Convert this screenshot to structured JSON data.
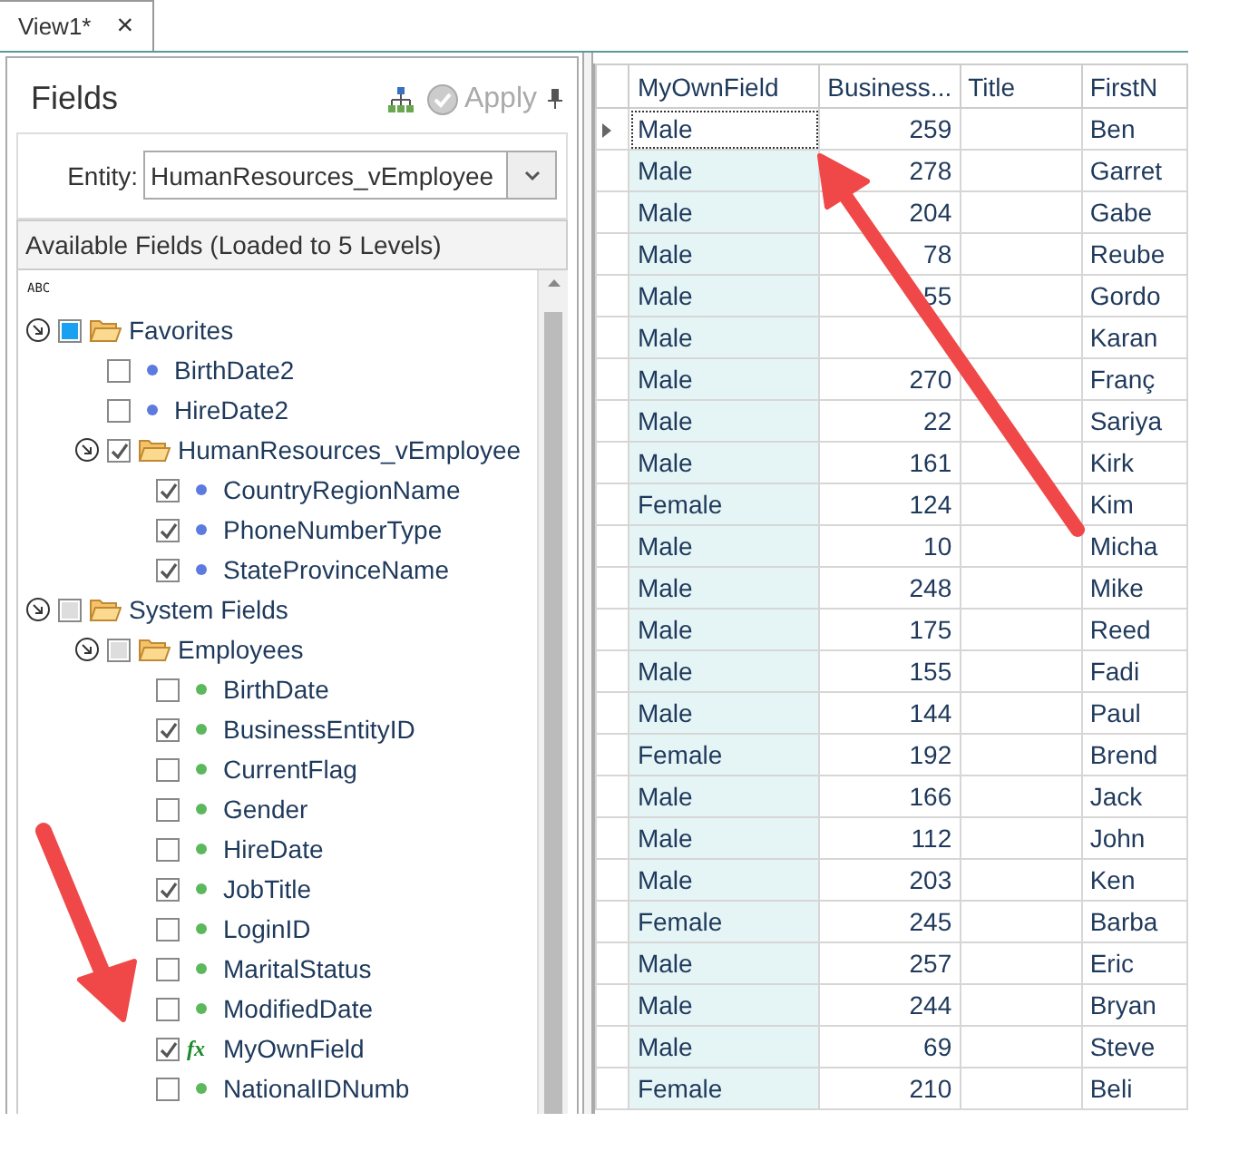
{
  "tab": {
    "label": "View1*",
    "close": "×"
  },
  "fields_panel": {
    "title": "Fields",
    "apply_button": {
      "label": "Apply",
      "disabled": true
    },
    "entity": {
      "label": "Entity:",
      "value": "HumanResources_vEmployee"
    },
    "available_header": "Available Fields (Loaded to 5 Levels)",
    "sort_button": "ABC",
    "tree": [
      {
        "kind": "folder",
        "label": "Favorites",
        "checked": false,
        "partial": true,
        "color": "#1aa0f0",
        "expanded": true,
        "children": [
          {
            "kind": "field",
            "label": "BirthDate2",
            "checked": false,
            "color": "#5b7be0"
          },
          {
            "kind": "field",
            "label": "HireDate2",
            "checked": false,
            "color": "#5b7be0"
          },
          {
            "kind": "folder",
            "label": "HumanResources_vEmployee",
            "checked": true,
            "expanded": true,
            "children": [
              {
                "kind": "field",
                "label": "CountryRegionName",
                "checked": true,
                "color": "#5b7be0"
              },
              {
                "kind": "field",
                "label": "PhoneNumberType",
                "checked": true,
                "color": "#5b7be0"
              },
              {
                "kind": "field",
                "label": "StateProvinceName",
                "checked": true,
                "color": "#5b7be0"
              }
            ]
          }
        ]
      },
      {
        "kind": "folder",
        "label": "System Fields",
        "checked": false,
        "partial": true,
        "color": "#dddddd",
        "expanded": true,
        "children": [
          {
            "kind": "folder",
            "label": "Employees",
            "checked": false,
            "partial": true,
            "color": "#dddddd",
            "expanded": true,
            "children": [
              {
                "kind": "field",
                "label": "BirthDate",
                "checked": false,
                "color": "#5cb85c"
              },
              {
                "kind": "field",
                "label": "BusinessEntityID",
                "checked": true,
                "color": "#5cb85c"
              },
              {
                "kind": "field",
                "label": "CurrentFlag",
                "checked": false,
                "color": "#5cb85c"
              },
              {
                "kind": "field",
                "label": "Gender",
                "checked": false,
                "color": "#5cb85c"
              },
              {
                "kind": "field",
                "label": "HireDate",
                "checked": false,
                "color": "#5cb85c"
              },
              {
                "kind": "field",
                "label": "JobTitle",
                "checked": true,
                "color": "#5cb85c"
              },
              {
                "kind": "field",
                "label": "LoginID",
                "checked": false,
                "color": "#5cb85c"
              },
              {
                "kind": "field",
                "label": "MaritalStatus",
                "checked": false,
                "color": "#5cb85c"
              },
              {
                "kind": "field",
                "label": "ModifiedDate",
                "checked": false,
                "color": "#5cb85c"
              },
              {
                "kind": "formula",
                "label": "MyOwnField",
                "checked": true,
                "badge": "fx"
              },
              {
                "kind": "field",
                "label": "NationalIDNumb",
                "checked": false,
                "color": "#5cb85c"
              }
            ]
          }
        ]
      }
    ]
  },
  "grid": {
    "columns": [
      {
        "label": "MyOwnField",
        "highlighted": true,
        "numeric": false
      },
      {
        "label": "Business...",
        "highlighted": false,
        "numeric": true
      },
      {
        "label": "Title",
        "highlighted": false
      },
      {
        "label": "FirstN",
        "highlighted": false,
        "numeric": false
      }
    ],
    "rows": [
      {
        "selected": true,
        "cells": [
          "Male",
          "259",
          "",
          "Ben"
        ]
      },
      {
        "selected": false,
        "cells": [
          "Male",
          "278",
          "",
          "Garret"
        ]
      },
      {
        "selected": false,
        "cells": [
          "Male",
          "204",
          "",
          "Gabe"
        ]
      },
      {
        "selected": false,
        "cells": [
          "Male",
          "78",
          "",
          "Reube"
        ]
      },
      {
        "selected": false,
        "cells": [
          "Male",
          "55",
          "",
          "Gordo"
        ]
      },
      {
        "selected": false,
        "cells": [
          "Male",
          "",
          "",
          "Karan"
        ]
      },
      {
        "selected": false,
        "cells": [
          "Male",
          "270",
          "",
          "Franç"
        ]
      },
      {
        "selected": false,
        "cells": [
          "Male",
          "22",
          "",
          "Sariya"
        ]
      },
      {
        "selected": false,
        "cells": [
          "Male",
          "161",
          "",
          "Kirk"
        ]
      },
      {
        "selected": false,
        "cells": [
          "Female",
          "124",
          "",
          "Kim"
        ]
      },
      {
        "selected": false,
        "cells": [
          "Male",
          "10",
          "",
          "Micha"
        ]
      },
      {
        "selected": false,
        "cells": [
          "Male",
          "248",
          "",
          "Mike"
        ]
      },
      {
        "selected": false,
        "cells": [
          "Male",
          "175",
          "",
          "Reed"
        ]
      },
      {
        "selected": false,
        "cells": [
          "Male",
          "155",
          "",
          "Fadi"
        ]
      },
      {
        "selected": false,
        "cells": [
          "Male",
          "144",
          "",
          "Paul"
        ]
      },
      {
        "selected": false,
        "cells": [
          "Female",
          "192",
          "",
          "Brend"
        ]
      },
      {
        "selected": false,
        "cells": [
          "Male",
          "166",
          "",
          "Jack"
        ]
      },
      {
        "selected": false,
        "cells": [
          "Male",
          "112",
          "",
          "John"
        ]
      },
      {
        "selected": false,
        "cells": [
          "Male",
          "203",
          "",
          "Ken"
        ]
      },
      {
        "selected": false,
        "cells": [
          "Female",
          "245",
          "",
          "Barba"
        ]
      },
      {
        "selected": false,
        "cells": [
          "Male",
          "257",
          "",
          "Eric"
        ]
      },
      {
        "selected": false,
        "cells": [
          "Male",
          "244",
          "",
          "Bryan"
        ]
      },
      {
        "selected": false,
        "cells": [
          "Male",
          "69",
          "",
          "Steve"
        ]
      },
      {
        "selected": false,
        "cells": [
          "Female",
          "210",
          "",
          "Beli"
        ]
      }
    ]
  }
}
